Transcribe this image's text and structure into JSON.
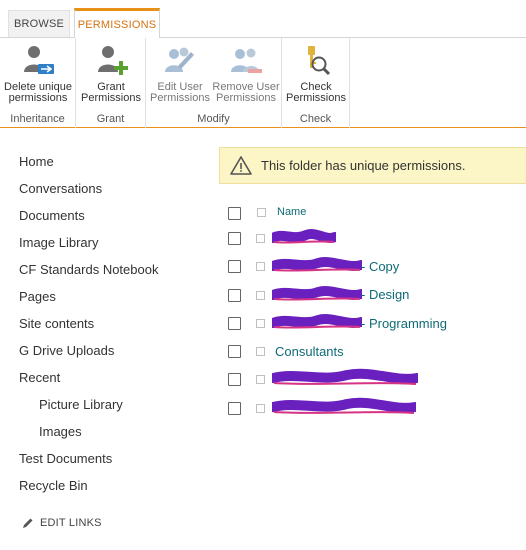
{
  "ribbon": {
    "tabs": [
      {
        "label": "BROWSE",
        "active": false
      },
      {
        "label": "PERMISSIONS",
        "active": true
      }
    ],
    "groups": [
      {
        "label": "Inheritance",
        "buttons": [
          {
            "label_line1": "Delete unique",
            "label_line2": "permissions",
            "icon": "delete-permissions-icon",
            "enabled": true
          }
        ]
      },
      {
        "label": "Grant",
        "buttons": [
          {
            "label_line1": "Grant",
            "label_line2": "Permissions",
            "icon": "grant-permissions-icon",
            "enabled": true
          }
        ]
      },
      {
        "label": "Modify",
        "buttons": [
          {
            "label_line1": "Edit User",
            "label_line2": "Permissions",
            "icon": "edit-user-permissions-icon",
            "enabled": false
          },
          {
            "label_line1": "Remove User",
            "label_line2": "Permissions",
            "icon": "remove-user-permissions-icon",
            "enabled": false
          }
        ]
      },
      {
        "label": "Check",
        "buttons": [
          {
            "label_line1": "Check",
            "label_line2": "Permissions",
            "icon": "check-permissions-icon",
            "enabled": true
          }
        ]
      }
    ]
  },
  "nav": {
    "items": [
      {
        "label": "Home"
      },
      {
        "label": "Conversations"
      },
      {
        "label": "Documents"
      },
      {
        "label": "Image Library"
      },
      {
        "label": "CF Standards Notebook"
      },
      {
        "label": "Pages"
      },
      {
        "label": "Site contents"
      },
      {
        "label": "G Drive Uploads"
      },
      {
        "label": "Recent"
      },
      {
        "label": "Picture Library"
      },
      {
        "label": "Images"
      },
      {
        "label": "Test Documents"
      },
      {
        "label": "Recycle Bin"
      }
    ],
    "edit_links": "EDIT LINKS"
  },
  "notice": {
    "message": "This folder has unique permissions."
  },
  "list": {
    "header": "Name",
    "rows": [
      {
        "visible_suffix": ""
      },
      {
        "visible_suffix": " - Copy"
      },
      {
        "visible_suffix": " - Design"
      },
      {
        "visible_suffix": " - Programming"
      },
      {
        "visible_suffix": "Consultants"
      },
      {
        "visible_suffix": ""
      },
      {
        "visible_suffix": ""
      }
    ]
  },
  "colors": {
    "accent": "#e7911a",
    "link": "#0f6a76",
    "notice_bg": "#fcf5c6",
    "redaction": "#6a1fbf"
  }
}
